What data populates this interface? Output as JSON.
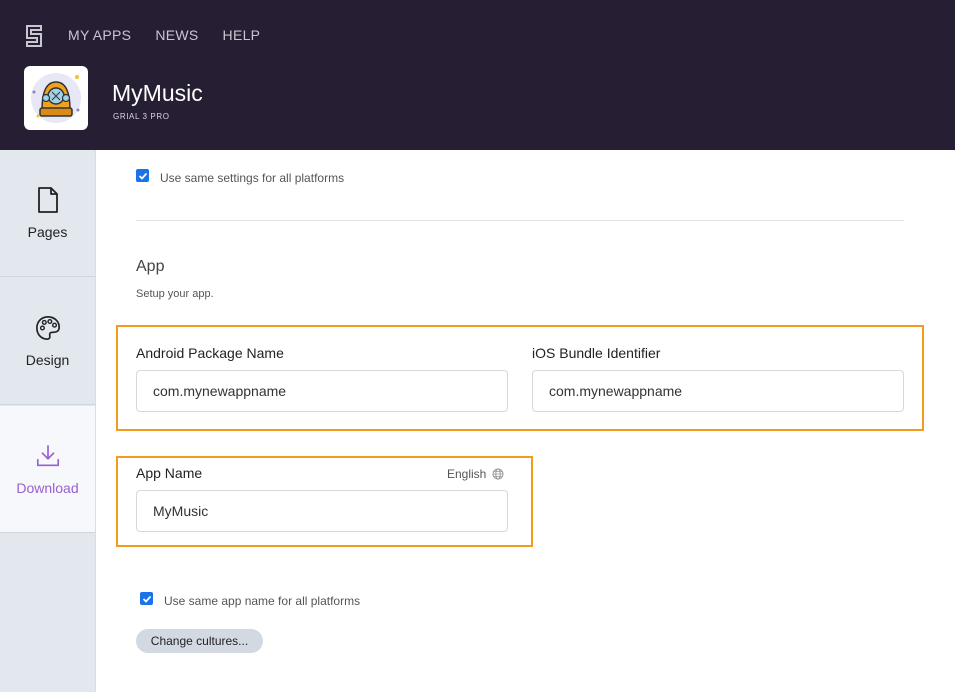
{
  "nav": {
    "items": [
      {
        "label": "MY APPS"
      },
      {
        "label": "NEWS"
      },
      {
        "label": "HELP"
      }
    ]
  },
  "app": {
    "title": "MyMusic",
    "subtitle": "GRIAL 3 PRO"
  },
  "sidebar": {
    "items": [
      {
        "label": "Pages",
        "icon": "file-icon"
      },
      {
        "label": "Design",
        "icon": "palette-icon"
      },
      {
        "label": "Download",
        "icon": "download-icon",
        "active": true
      }
    ]
  },
  "main": {
    "same_settings_label": "Use same settings for all platforms",
    "section_title": "App",
    "section_sub": "Setup your app.",
    "android_label": "Android Package Name",
    "android_value": "com.mynewappname",
    "ios_label": "iOS Bundle Identifier",
    "ios_value": "com.mynewappname",
    "app_name_label": "App Name",
    "language": "English",
    "app_name_value": "MyMusic",
    "same_name_label": "Use same app name for all platforms",
    "change_cultures": "Change cultures..."
  },
  "colors": {
    "header_bg": "#261f33",
    "highlight": "#f29b1d",
    "accent": "#9a5fd0",
    "checkbox": "#1a73e8"
  }
}
